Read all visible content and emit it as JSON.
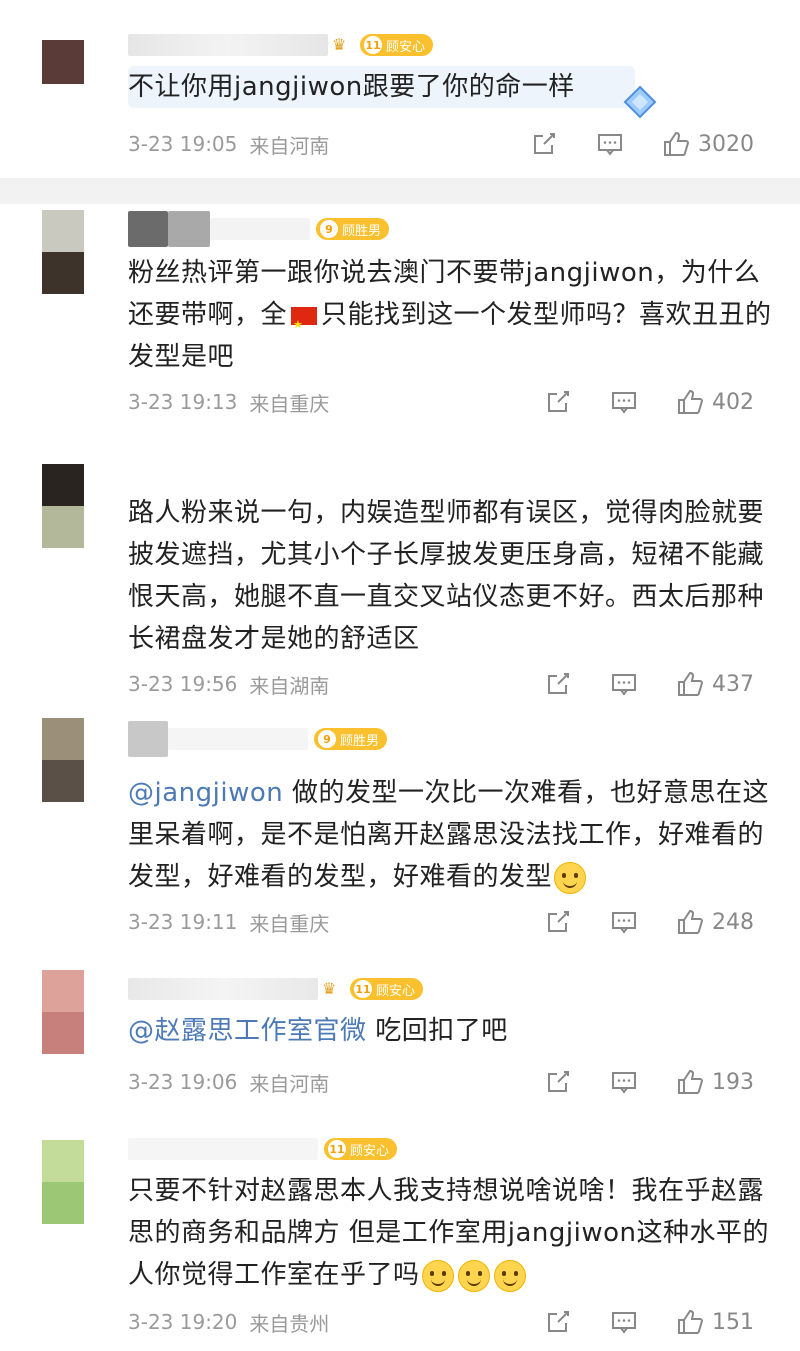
{
  "comments": [
    {
      "badge_level": "11",
      "badge_name": "顾安心",
      "text": "不让你用jangjiwon跟要了你的命一样",
      "time": "3-23 19:05",
      "location": "来自河南",
      "likes": "3020"
    },
    {
      "badge_level": "9",
      "badge_name": "顾胜男",
      "text_a": "粉丝热评第一跟你说去澳门不要带jangjiwon，为什么还要带啊，全",
      "text_b": "只能找到这一个发型师吗？喜欢丑丑的发型是吧",
      "time": "3-23 19:13",
      "location": "来自重庆",
      "likes": "402"
    },
    {
      "text": "路人粉来说一句，内娱造型师都有误区，觉得肉脸就要披发遮挡，尤其小个子长厚披发更压身高，短裙不能藏恨天高，她腿不直一直交叉站仪态更不好。西太后那种长裙盘发才是她的舒适区",
      "time": "3-23 19:56",
      "location": "来自湖南",
      "likes": "437"
    },
    {
      "badge_level": "9",
      "badge_name": "顾胜男",
      "mention": "@jangjiwon",
      "text": " 做的发型一次比一次难看，也好意思在这里呆着啊，是不是怕离开赵露思没法找工作，好难看的发型，好难看的发型，好难看的发型",
      "time": "3-23 19:11",
      "location": "来自重庆",
      "likes": "248"
    },
    {
      "badge_level": "11",
      "badge_name": "顾安心",
      "mention": "@赵露思工作室官微",
      "text": " 吃回扣了吧",
      "time": "3-23 19:06",
      "location": "来自河南",
      "likes": "193"
    },
    {
      "badge_level": "11",
      "badge_name": "顾安心",
      "text": "只要不针对赵露思本人我支持想说啥说啥！我在乎赵露思的商务和品牌方 但是工作室用jangjiwon这种水平的人你觉得工作室在乎了吗",
      "time": "3-23 19:20",
      "location": "来自贵州",
      "likes": "151"
    }
  ],
  "icons": [
    "share-icon",
    "comment-icon",
    "like-icon",
    "crown-icon",
    "diamond-icon",
    "china-flag-icon",
    "smile-emoji-icon"
  ],
  "colors": {
    "mention": "#4d7ab6",
    "badge": "#fbc02d",
    "meta": "#9a9a9a"
  }
}
